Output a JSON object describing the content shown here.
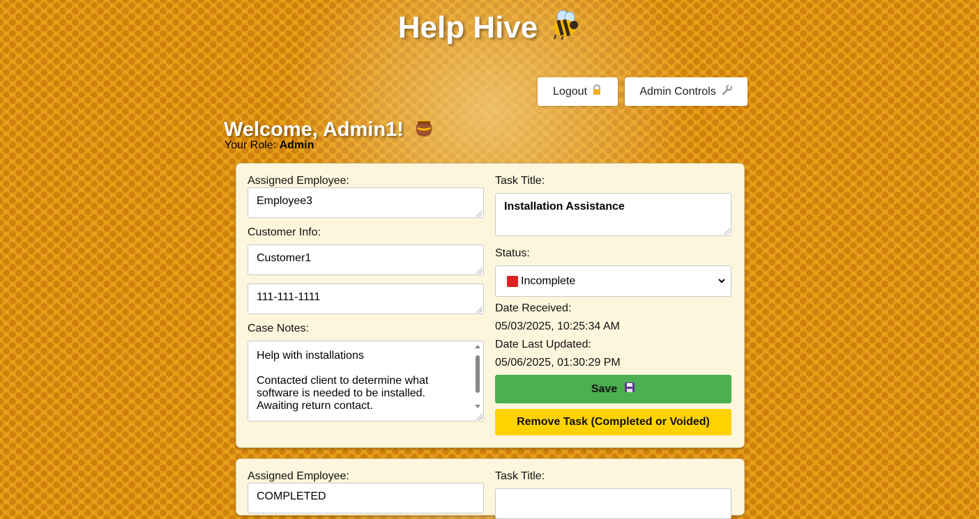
{
  "header": {
    "title": "Help Hive",
    "icon": "bee-icon"
  },
  "toolbar": {
    "logout_label": "Logout",
    "logout_icon": "lock-icon",
    "admin_label": "Admin Controls",
    "admin_icon": "wrench-icon"
  },
  "welcome": {
    "text": "Welcome, Admin1!",
    "icon": "honey-pot-icon",
    "role_label": "Your Role:",
    "role_value": "Admin"
  },
  "tasks": [
    {
      "assigned_label": "Assigned Employee:",
      "assigned_value": "Employee3",
      "customer_label": "Customer Info:",
      "customer_name": "Customer1",
      "customer_phone": "111-111-1111",
      "notes_label": "Case Notes:",
      "notes_value": "Help with installations\n\nContacted client to determine what software is needed to be installed. Awaiting return contact.",
      "title_label": "Task Title:",
      "title_value": "Installation Assistance",
      "status_label": "Status:",
      "status_value": "Incomplete",
      "status_color": "#e02020",
      "received_label": "Date Received:",
      "received_value": "05/03/2025, 10:25:34 AM",
      "updated_label": "Date Last Updated:",
      "updated_value": "05/06/2025, 01:30:29 PM",
      "save_label": "Save",
      "save_icon": "floppy-disk-icon",
      "remove_label": "Remove Task (Completed or Voided)"
    },
    {
      "assigned_label": "Assigned Employee:",
      "assigned_value": "COMPLETED",
      "title_label": "Task Title:"
    }
  ],
  "colors": {
    "save": "#4caf50",
    "remove": "#ffd200",
    "card": "#fdf6dc",
    "background": "#e8a21a"
  }
}
